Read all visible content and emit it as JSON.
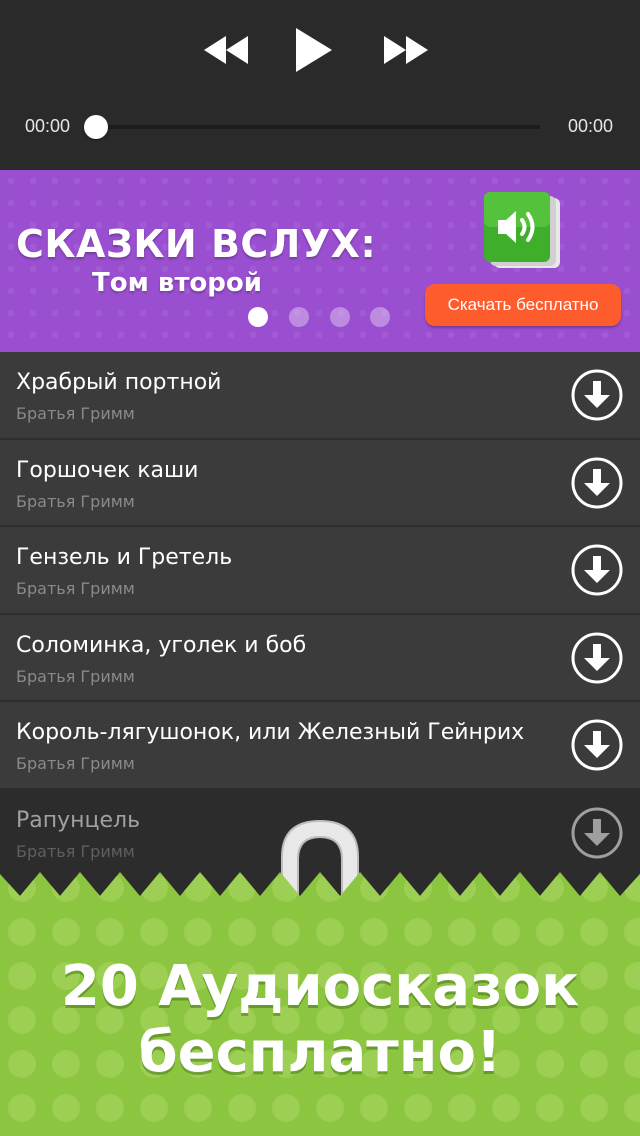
{
  "player": {
    "time_elapsed": "00:00",
    "time_total": "00:00",
    "progress": 0,
    "icons": [
      "rewind-icon",
      "play-icon",
      "fast-forward-icon"
    ]
  },
  "banner": {
    "title": "СКАЗКИ ВСЛУХ:",
    "subtitle": "Том второй",
    "download_label": "Скачать бесплатно",
    "active_dot": 1,
    "dot_count": 4,
    "colors": {
      "background": "#9a4fd0",
      "button": "#ff5c2e",
      "icon": "#3fae2a"
    }
  },
  "tales": [
    {
      "title": "Храбрый портной",
      "author": "Братья Гримм"
    },
    {
      "title": "Горшочек каши",
      "author": "Братья Гримм"
    },
    {
      "title": "Гензель и Гретель",
      "author": "Братья Гримм"
    },
    {
      "title": "Соломинка, уголек и боб",
      "author": "Братья Гримм"
    },
    {
      "title": "Король-лягушонок, или Железный Гейнрих",
      "author": "Братья Гримм"
    },
    {
      "title": "Рапунцель",
      "author": "Братья Гримм"
    }
  ],
  "promo": {
    "line1": "20 Аудиосказок",
    "line2": "бесплатно!",
    "color": "#8cc540"
  }
}
